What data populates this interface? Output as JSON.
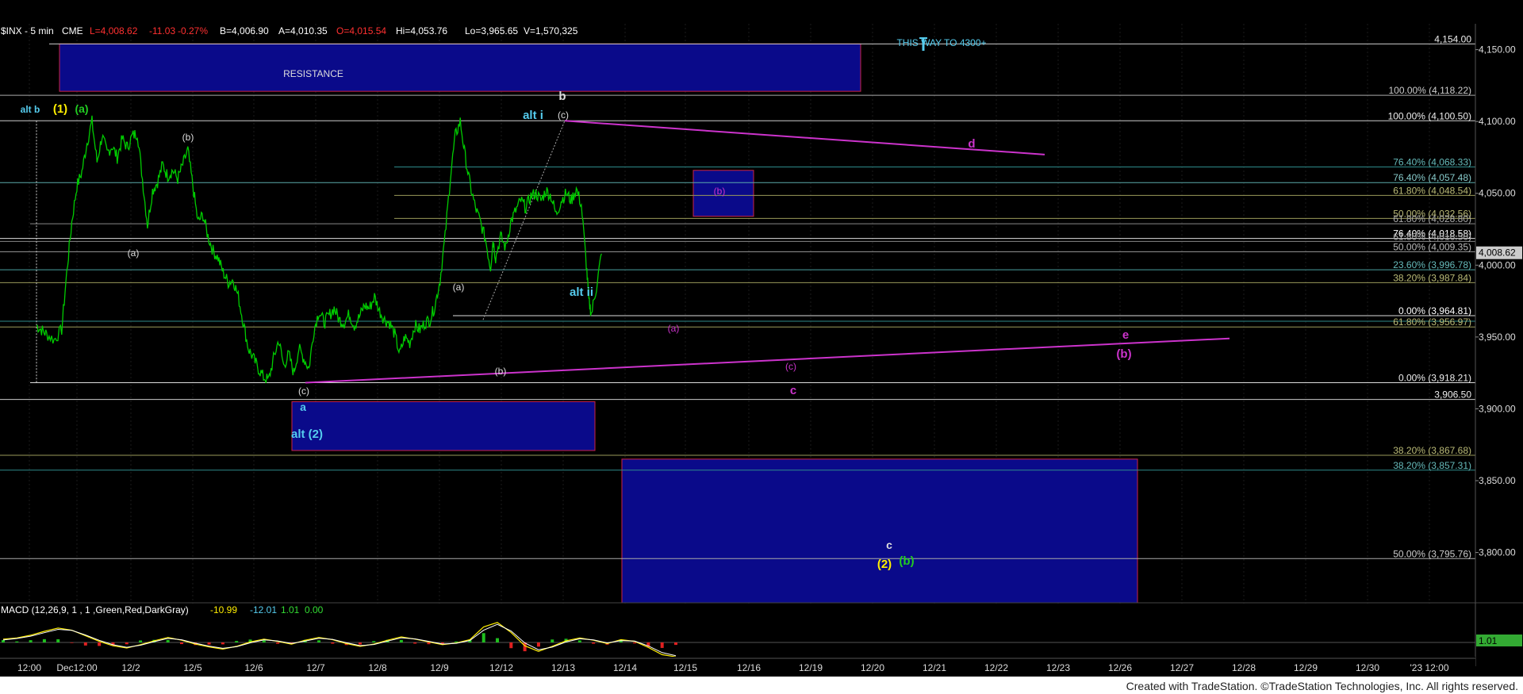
{
  "header": {
    "symbol": "$INX - 5 min",
    "exchange": "CME",
    "last": "L=4,008.62",
    "change": "-11.03",
    "change_pct": "-0.27%",
    "bid": "B=4,006.90",
    "ask": "A=4,010.35",
    "open": "O=4,015.54",
    "high": "Hi=4,053.76",
    "low": "Lo=3,965.65",
    "volume": "V=1,570,325"
  },
  "macd_header": {
    "name": "MACD (12,26,9, 1 , 1 ,Green,Red,DarkGray)",
    "v1": "-10.99",
    "v2": "-12.01",
    "v3": "1.01",
    "v4": "0.00"
  },
  "footer": "Created with TradeStation. ©TradeStation Technologies, Inc. All rights reserved.",
  "colors": {
    "price": "#00cc00",
    "magenta": "#cc33cc",
    "cyan": "#55ccee",
    "yellow": "#ffee00",
    "green": "#22cc22",
    "white": "#dddddd",
    "box_fill": "#0a0a8a",
    "box_border": "#cc2244"
  },
  "chart_data": {
    "type": "line",
    "ylim": [
      3765,
      4168
    ],
    "y_ticks": [
      "4,150.00",
      "4,100.00",
      "4,050.00",
      "4,000.00",
      "3,950.00",
      "3,900.00",
      "3,850.00",
      "3,800.00"
    ],
    "y_tick_values": [
      4150,
      4100,
      4050,
      4000,
      3950,
      3900,
      3850,
      3800
    ],
    "x_ticks": [
      "12:00",
      "Dec12:00",
      "12/2",
      "12/5",
      "12/6",
      "12/7",
      "12/8",
      "12/9",
      "12/12",
      "12/13",
      "12/14",
      "12/15",
      "12/16",
      "12/19",
      "12/20",
      "12/21",
      "12/22",
      "12/23",
      "12/26",
      "12/27",
      "12/28",
      "12/29",
      "12/30",
      "'23 12:00"
    ],
    "last_price_label": "4,008.62",
    "macd_last_label": "1.01",
    "series": [
      {
        "name": "$INX",
        "x": [
          0,
          0.1,
          0.2,
          0.35,
          0.5,
          0.6,
          0.7,
          0.8,
          0.9,
          1.0,
          1.1,
          1.2,
          1.3,
          1.4,
          1.5,
          1.6,
          1.7,
          1.8,
          1.9,
          2.0,
          2.1,
          2.2,
          2.3,
          2.4,
          2.5,
          2.6,
          2.7,
          2.8,
          2.9,
          3.0,
          3.1,
          3.2,
          3.3,
          3.4,
          3.5,
          3.6,
          3.7,
          3.8,
          3.9,
          4.0,
          4.1,
          4.2,
          4.3,
          4.4,
          4.5,
          4.6,
          4.7,
          4.8,
          4.9,
          5.0,
          5.1,
          5.2,
          5.3,
          5.4,
          5.5,
          5.6,
          5.7,
          5.8,
          5.9,
          6.0,
          6.1,
          6.2,
          6.3,
          6.4,
          6.5,
          6.6,
          6.7,
          6.8,
          6.9,
          7.0,
          7.1,
          7.2,
          7.3,
          7.4,
          7.5,
          7.6,
          7.7,
          7.8,
          7.9,
          8.0,
          8.1,
          8.2,
          8.3,
          8.4,
          8.5,
          8.6,
          8.7,
          8.8,
          8.9,
          9.0,
          9.05,
          9.1,
          9.2,
          9.3,
          9.4,
          9.5,
          9.6,
          9.7,
          9.8,
          9.9,
          10.0,
          10.1,
          10.2,
          10.3,
          10.4,
          10.5,
          10.6,
          10.7,
          10.8,
          10.9,
          10.95,
          11.0,
          11.1,
          11.2
        ],
        "values": [
          3958,
          3955,
          3952,
          3948,
          3955,
          3995,
          4030,
          4055,
          4065,
          4085,
          4100,
          4072,
          4090,
          4078,
          4083,
          4075,
          4088,
          4082,
          4090,
          4092,
          4060,
          4028,
          4052,
          4058,
          4070,
          4062,
          4066,
          4060,
          4070,
          4080,
          4055,
          4030,
          4035,
          4020,
          4010,
          4005,
          3995,
          3988,
          3990,
          3978,
          3960,
          3942,
          3935,
          3928,
          3922,
          3920,
          3935,
          3948,
          3930,
          3938,
          3925,
          3942,
          3935,
          3928,
          3955,
          3968,
          3960,
          3965,
          3970,
          3962,
          3960,
          3966,
          3958,
          3964,
          3972,
          3970,
          3978,
          3968,
          3962,
          3960,
          3952,
          3938,
          3950,
          3946,
          3958,
          3955,
          3960,
          3962,
          3972,
          3990,
          4020,
          4060,
          4090,
          4100,
          4075,
          4055,
          4040,
          4030,
          4018,
          3998,
          4018,
          4005,
          4020,
          4012,
          4030,
          4038,
          4045,
          4040,
          4048,
          4050,
          4045,
          4052,
          4048,
          4035,
          4045,
          4050,
          4045,
          4053,
          4042,
          4000,
          3975,
          3966,
          3985,
          4008
        ]
      },
      {
        "name": "MACD",
        "values": [
          0.6,
          0.8,
          1.3,
          2.0,
          2.6,
          2.2,
          1.2,
          0.2,
          -0.6,
          -1.0,
          -0.4,
          0.3,
          0.9,
          0.4,
          -0.3,
          -0.8,
          -1.2,
          -0.7,
          0.1,
          0.6,
          0.2,
          -0.3,
          0.4,
          0.9,
          0.5,
          -0.2,
          -0.7,
          -0.3,
          0.4,
          1.0,
          0.6,
          0.1,
          -0.4,
          -0.1,
          0.5,
          2.8,
          3.6,
          1.8,
          -0.6,
          -1.6,
          -0.7,
          0.3,
          0.8,
          0.4,
          -0.2,
          0.5,
          0.2,
          -0.9,
          -2.2,
          -2.6
        ]
      }
    ]
  },
  "hlines": [
    {
      "price": 4154.0,
      "label": "4,154.00",
      "color": "#cccccc",
      "label_color": "#eeeeee",
      "from": 62
    },
    {
      "price": 4118.22,
      "label": "100.00% (4,118.22)",
      "color": "#aaaaaa",
      "label_color": "#cccccc",
      "from": 0
    },
    {
      "price": 4100.5,
      "label": "100.00% (4,100.50)",
      "color": "#cccccc",
      "label_color": "#eeeeee",
      "from": 0
    },
    {
      "price": 4068.33,
      "label": "76.40% (4,068.33)",
      "color": "#2e8a8a",
      "label_color": "#66bbbb",
      "from": 497
    },
    {
      "price": 4057.48,
      "label": "76.40% (4,057.48)",
      "color": "#5aaaaa",
      "label_color": "#88cccc",
      "from": 0
    },
    {
      "price": 4048.54,
      "label": "61.80% (4,048.54)",
      "color": "#9a9a5a",
      "label_color": "#bbbb77",
      "from": 497
    },
    {
      "price": 4032.56,
      "label": "50.00% (4,032.56)",
      "color": "#9a9a5a",
      "label_color": "#bbbb77",
      "from": 497
    },
    {
      "price": 4028.8,
      "label": "61.80% (4,028.80)",
      "color": "#888888",
      "label_color": "#aaaaaa",
      "from": 38
    },
    {
      "price": 4018.58,
      "label": "76.40% (4,018.58)",
      "color": "#dddddd",
      "label_color": "#ffffff",
      "from": 0
    },
    {
      "price": 4016.5,
      "label": "61.80% (4,016.50)",
      "color": "#888888",
      "label_color": "#aaaaaa",
      "from": 0
    },
    {
      "price": 4009.35,
      "label": "50.00% (4,009.35)",
      "color": "#999999",
      "label_color": "#bbbbbb",
      "from": 0
    },
    {
      "price": 3996.78,
      "label": "23.60% (3,996.78)",
      "color": "#4aa0a0",
      "label_color": "#66bbbb",
      "from": 0
    },
    {
      "price": 3987.84,
      "label": "38.20% (3,987.84)",
      "color": "#9a9a5a",
      "label_color": "#bbbb77",
      "from": 0
    },
    {
      "price": 3964.81,
      "label": "0.00% (3,964.81)",
      "color": "#dddddd",
      "label_color": "#ffffff",
      "from": 571
    },
    {
      "price": 3961.0,
      "label": "",
      "color": "#2e8a8a",
      "label_color": "#66bbbb",
      "from": 0
    },
    {
      "price": 3957.0,
      "label": "61.80% (3,956.97)",
      "color": "#9a9a5a",
      "label_color": "#bbbb77",
      "from": 0
    },
    {
      "price": 3918.21,
      "label": "0.00% (3,918.21)",
      "color": "#dddddd",
      "label_color": "#eeeeee",
      "from": 38
    },
    {
      "price": 3906.5,
      "label": "3,906.50",
      "color": "#cccccc",
      "label_color": "#eeeeee",
      "from": 0
    },
    {
      "price": 3867.68,
      "label": "38.20% (3,867.68)",
      "color": "#9a9a5a",
      "label_color": "#bbbb77",
      "from": 0
    },
    {
      "price": 3857.31,
      "label": "38.20% (3,857.31)",
      "color": "#2e8a8a",
      "label_color": "#66bbbb",
      "from": 0
    },
    {
      "price": 3795.76,
      "label": "50.00% (3,795.76)",
      "color": "#aaaaaa",
      "label_color": "#cccccc",
      "from": 0
    }
  ],
  "annotations": [
    {
      "text": "alt b",
      "color": "#55ccee",
      "bold": true,
      "size": 12,
      "pos": [
        38,
        142
      ]
    },
    {
      "text": "(1)",
      "color": "#ffee00",
      "bold": true,
      "size": 15,
      "pos": [
        76,
        142
      ]
    },
    {
      "text": "(a)",
      "color": "#22cc22",
      "bold": true,
      "size": 14,
      "pos": [
        103,
        142
      ]
    },
    {
      "text": "(b)",
      "color": "#dddddd",
      "bold": false,
      "size": 12,
      "pos": [
        237,
        177
      ]
    },
    {
      "text": "(a)",
      "color": "#dddddd",
      "bold": false,
      "size": 12,
      "pos": [
        168,
        323
      ]
    },
    {
      "text": "(c)",
      "color": "#dddddd",
      "bold": false,
      "size": 12,
      "pos": [
        383,
        497
      ]
    },
    {
      "text": "a",
      "color": "#55ccee",
      "bold": true,
      "size": 14,
      "pos": [
        382,
        518
      ]
    },
    {
      "text": "alt (2)",
      "color": "#55ccee",
      "bold": true,
      "size": 15,
      "pos": [
        387,
        552
      ]
    },
    {
      "text": "(a)",
      "color": "#dddddd",
      "bold": false,
      "size": 12,
      "pos": [
        578,
        366
      ]
    },
    {
      "text": "(b)",
      "color": "#dddddd",
      "bold": false,
      "size": 12,
      "pos": [
        631,
        472
      ]
    },
    {
      "text": "alt i",
      "color": "#55ccee",
      "bold": true,
      "size": 15,
      "pos": [
        672,
        150
      ]
    },
    {
      "text": "b",
      "color": "#dddddd",
      "bold": true,
      "size": 15,
      "pos": [
        709,
        126
      ]
    },
    {
      "text": "(c)",
      "color": "#dddddd",
      "bold": false,
      "size": 12,
      "pos": [
        710,
        149
      ]
    },
    {
      "text": "alt ii",
      "color": "#55ccee",
      "bold": true,
      "size": 15,
      "pos": [
        733,
        373
      ]
    },
    {
      "text": "(a)",
      "color": "#cc33cc",
      "bold": false,
      "size": 12,
      "pos": [
        849,
        418
      ]
    },
    {
      "text": "(b)",
      "color": "#cc33cc",
      "bold": false,
      "size": 12,
      "pos": [
        907,
        245
      ]
    },
    {
      "text": "d",
      "color": "#cc33cc",
      "bold": true,
      "size": 15,
      "pos": [
        1225,
        186
      ]
    },
    {
      "text": "(c)",
      "color": "#cc33cc",
      "bold": false,
      "size": 12,
      "pos": [
        997,
        466
      ]
    },
    {
      "text": "c",
      "color": "#cc33cc",
      "bold": true,
      "size": 15,
      "pos": [
        1000,
        497
      ]
    },
    {
      "text": "e",
      "color": "#cc33cc",
      "bold": true,
      "size": 15,
      "pos": [
        1419,
        427
      ]
    },
    {
      "text": "(b)",
      "color": "#cc33cc",
      "bold": true,
      "size": 15,
      "pos": [
        1417,
        451
      ]
    },
    {
      "text": "c",
      "color": "#dddddd",
      "bold": true,
      "size": 14,
      "pos": [
        1121,
        692
      ]
    },
    {
      "text": "(2)",
      "color": "#ffee00",
      "bold": true,
      "size": 15,
      "pos": [
        1115,
        716
      ]
    },
    {
      "text": "(b)",
      "color": "#22cc22",
      "bold": true,
      "size": 15,
      "pos": [
        1143,
        712
      ]
    },
    {
      "text": "THIS WAY TO 4300+",
      "color": "#55ccee",
      "bold": false,
      "size": 12,
      "pos": [
        1187,
        58
      ]
    },
    {
      "text": "RESISTANCE",
      "color": "#dddddd",
      "bold": false,
      "size": 12,
      "pos": [
        395,
        97
      ]
    }
  ]
}
